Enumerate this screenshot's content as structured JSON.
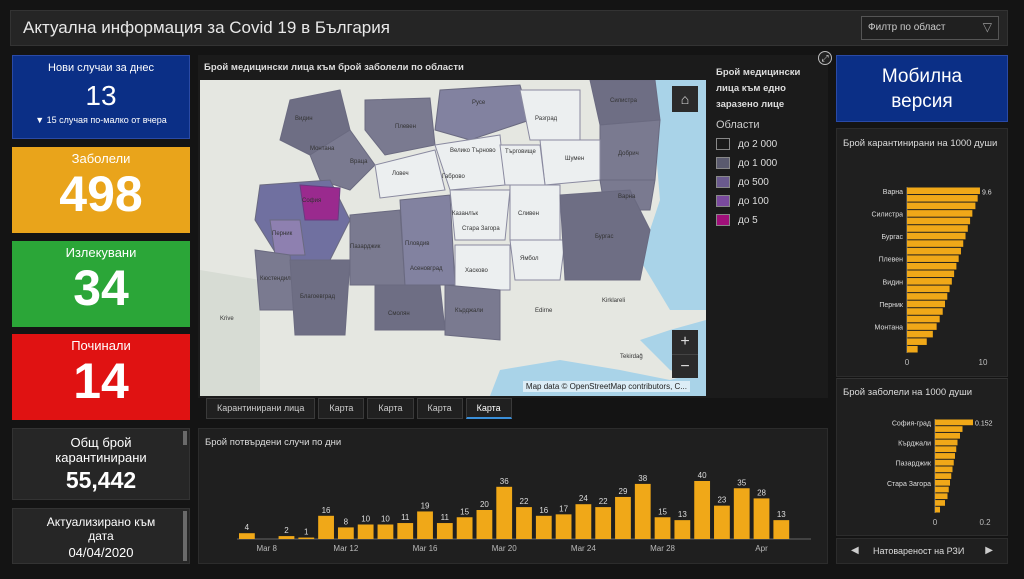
{
  "header": {
    "title": "Актуална информация за Covid 19 в България",
    "filter_label": "Филтр по област"
  },
  "kpis": {
    "new_today": {
      "label": "Нови случаи за днес",
      "value": "13",
      "note": "▼ 15 случая по-малко от вчера"
    },
    "infected": {
      "label": "Заболели",
      "value": "498"
    },
    "recovered": {
      "label": "Излекувани",
      "value": "34"
    },
    "deceased": {
      "label": "Починали",
      "value": "14"
    },
    "quarantined": {
      "label": "Общ брой карантинирани",
      "value": "55,442"
    },
    "updated": {
      "label": "Актуализирано към дата",
      "value": "04/04/2020"
    }
  },
  "map": {
    "title": "Брой медицински лица към брой заболели по области",
    "legend_title": "Брой медицински лица към едно заразено лице",
    "legend_subtitle": "Области",
    "legend": [
      {
        "label": "до 2 000",
        "color": "#1a1a1a"
      },
      {
        "label": "до 1 000",
        "color": "#5a5a6e"
      },
      {
        "label": "до 500",
        "color": "#6a5a8e"
      },
      {
        "label": "до 100",
        "color": "#7a4a9e"
      },
      {
        "label": "до 5",
        "color": "#a0107a"
      }
    ],
    "attribution": "Map data © OpenStreetMap contributors, C...",
    "labels": [
      "Видин",
      "Плевен",
      "Ловеч",
      "Враца",
      "Монтана",
      "Русе",
      "Силистра",
      "Добрич",
      "Варна",
      "Шумен",
      "Търговище",
      "Разград",
      "Велико Търново",
      "Габрово",
      "София",
      "Перник",
      "Кюстендил",
      "Пазарджик",
      "Пловдив",
      "Стара Загора",
      "Казанлък",
      "Сливен",
      "Ямбол",
      "Бургас",
      "Хасково",
      "Смолян",
      "Кърджали",
      "Благоевград",
      "Асеновград",
      "Edirne",
      "Kirklareli",
      "Tekirdağ",
      "Krive"
    ]
  },
  "tabs": [
    "Карантинирани лица",
    "Карта",
    "Карта",
    "Карта",
    "Карта"
  ],
  "mobile": {
    "label": "Мобилна версия"
  },
  "daily_chart": {
    "title": "Брой потвърдени случи по дни"
  },
  "right_top": {
    "title": "Брой карантинирани на 1000 души"
  },
  "right_bottom": {
    "title": "Брой заболели на 1000 души"
  },
  "footer_nav": {
    "label": "Натовареност на РЗИ"
  },
  "chart_data": [
    {
      "type": "bar",
      "title": "Брой потвърдени случи по дни",
      "categories": [
        "Mar 7",
        "Mar 8",
        "Mar 9",
        "Mar 10",
        "Mar 11",
        "Mar 12",
        "Mar 13",
        "Mar 14",
        "Mar 15",
        "Mar 16",
        "Mar 17",
        "Mar 18",
        "Mar 19",
        "Mar 20",
        "Mar 21",
        "Mar 22",
        "Mar 23",
        "Mar 24",
        "Mar 25",
        "Mar 26",
        "Mar 27",
        "Mar 28",
        "Mar 29",
        "Mar 30",
        "Mar 31",
        "Apr 1",
        "Apr 2",
        "Apr 3",
        "Apr 4"
      ],
      "values": [
        4,
        0,
        2,
        1,
        16,
        8,
        10,
        10,
        11,
        19,
        11,
        15,
        20,
        36,
        22,
        16,
        17,
        24,
        22,
        29,
        38,
        15,
        13,
        40,
        23,
        35,
        28,
        13,
        0
      ],
      "x_ticks": [
        "Mar 8",
        "Mar 12",
        "Mar 16",
        "Mar 20",
        "Mar 24",
        "Mar 28",
        "Apr"
      ],
      "color": "#f0a818"
    },
    {
      "type": "bar",
      "title": "Брой карантинирани на 1000 души",
      "orientation": "horizontal",
      "categories": [
        "Варна",
        "",
        "",
        "Силистра",
        "",
        "",
        "Бургас",
        "",
        "",
        "Плевен",
        "",
        "",
        "Видин",
        "",
        "",
        "Перник",
        "",
        "",
        "Монтана",
        "",
        "",
        ""
      ],
      "values": [
        9.6,
        9.3,
        9.0,
        8.6,
        8.3,
        8.0,
        7.7,
        7.4,
        7.1,
        6.8,
        6.5,
        6.2,
        5.9,
        5.6,
        5.3,
        5.0,
        4.7,
        4.3,
        3.9,
        3.4,
        2.6,
        1.4
      ],
      "xlim": [
        0,
        10
      ],
      "x_ticks": [
        "0",
        "10"
      ],
      "first_label": "9.6",
      "color": "#f0a818"
    },
    {
      "type": "bar",
      "title": "Брой заболели на 1000 души",
      "orientation": "horizontal",
      "categories": [
        "София-град",
        "",
        "",
        "Кърджали",
        "",
        "",
        "Пазарджик",
        "",
        "",
        "Стара Загора",
        "",
        "",
        "",
        ""
      ],
      "values": [
        0.152,
        0.11,
        0.1,
        0.09,
        0.085,
        0.08,
        0.075,
        0.07,
        0.065,
        0.06,
        0.055,
        0.05,
        0.04,
        0.02
      ],
      "xlim": [
        0,
        0.2
      ],
      "x_ticks": [
        "0",
        "0.2"
      ],
      "first_label": "0.152",
      "color": "#f0a818"
    }
  ]
}
